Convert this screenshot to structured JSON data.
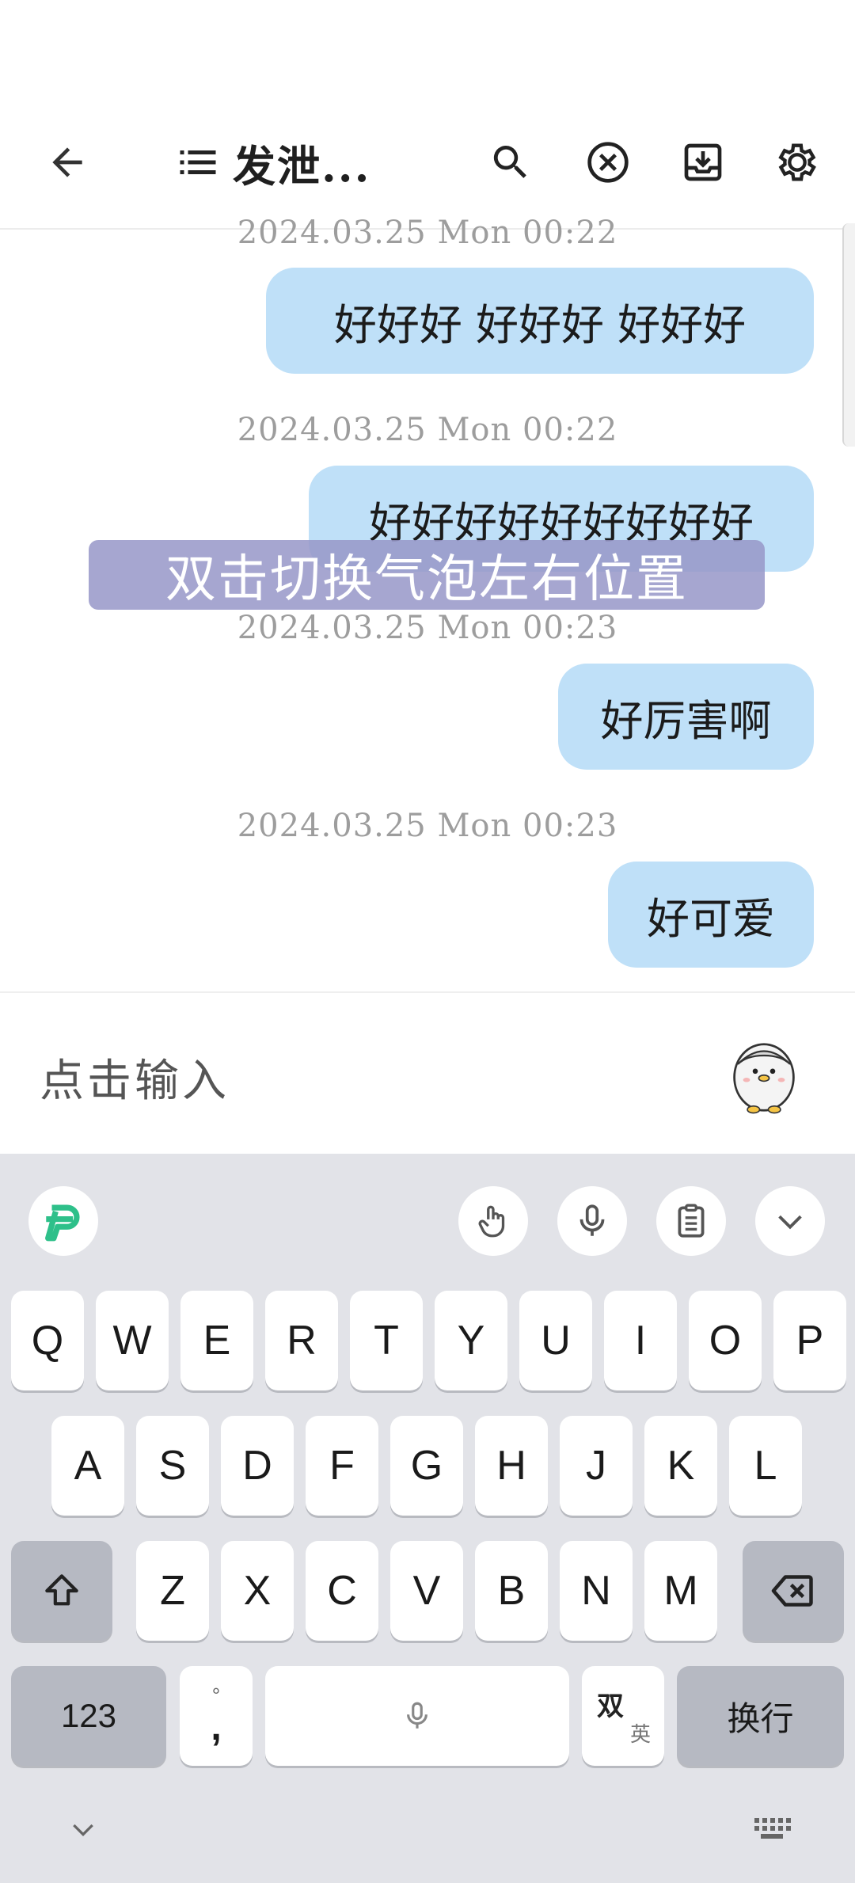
{
  "header": {
    "title": "发泄...",
    "icons": [
      "back-arrow-icon",
      "list-icon",
      "search-icon",
      "close-circle-icon",
      "download-icon",
      "gear-icon"
    ]
  },
  "chat": {
    "messages": [
      {
        "timestamp": "2024.03.25 Mon 00:22",
        "text": "好好好 好好好 好好好"
      },
      {
        "timestamp": "2024.03.25 Mon 00:22",
        "text": "好好好好好好好好好"
      },
      {
        "timestamp": "2024.03.25 Mon 00:23",
        "text": "好厉害啊"
      },
      {
        "timestamp": "2024.03.25 Mon 00:23",
        "text": "好可爱"
      }
    ],
    "overlay_tip": "双击切换气泡左右位置"
  },
  "input": {
    "placeholder": "点击输入",
    "avatar": "penguin-sticker-icon"
  },
  "keyboard": {
    "row1": [
      "Q",
      "W",
      "E",
      "R",
      "T",
      "Y",
      "U",
      "I",
      "O",
      "P"
    ],
    "row2": [
      "A",
      "S",
      "D",
      "F",
      "G",
      "H",
      "J",
      "K",
      "L"
    ],
    "row3": [
      "Z",
      "X",
      "C",
      "V",
      "B",
      "N",
      "M"
    ],
    "num_label": "123",
    "punct_top": "°",
    "punct_bottom": ",",
    "lang_top": "双",
    "lang_bottom": "英",
    "enter_label": "换行",
    "colors": {
      "background": "#e2e3e8",
      "key": "#ffffff",
      "key_dark": "#b6b9c2",
      "accent": "#2ec08a"
    }
  }
}
